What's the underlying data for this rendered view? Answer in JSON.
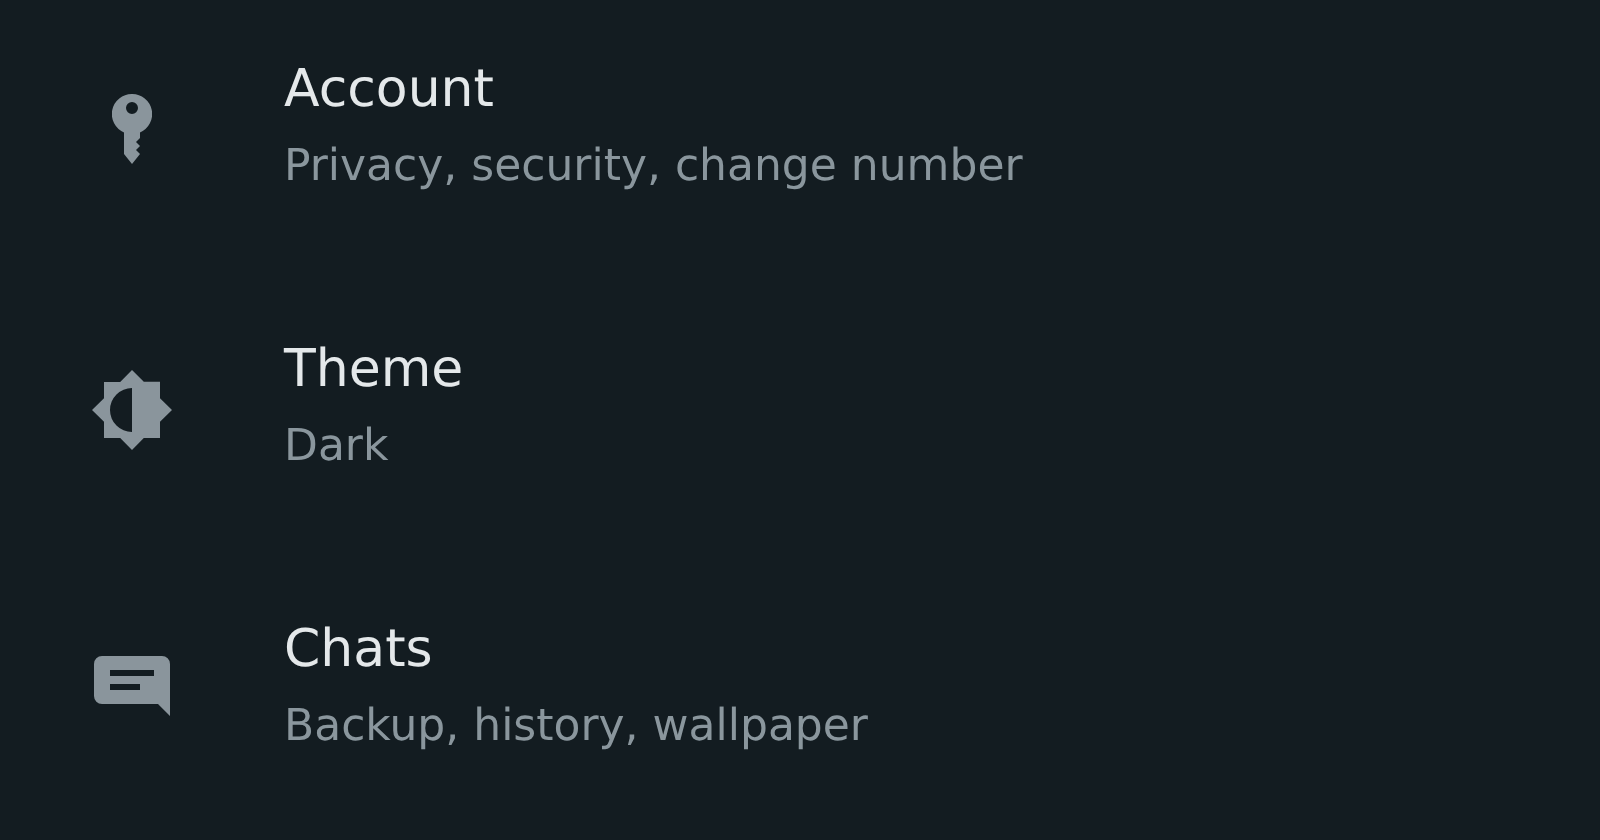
{
  "settings": [
    {
      "kind": "account",
      "title": "Account",
      "subtitle": "Privacy, security, change number"
    },
    {
      "kind": "theme",
      "title": "Theme",
      "subtitle": "Dark"
    },
    {
      "kind": "chats",
      "title": "Chats",
      "subtitle": "Backup, history, wallpaper"
    }
  ]
}
